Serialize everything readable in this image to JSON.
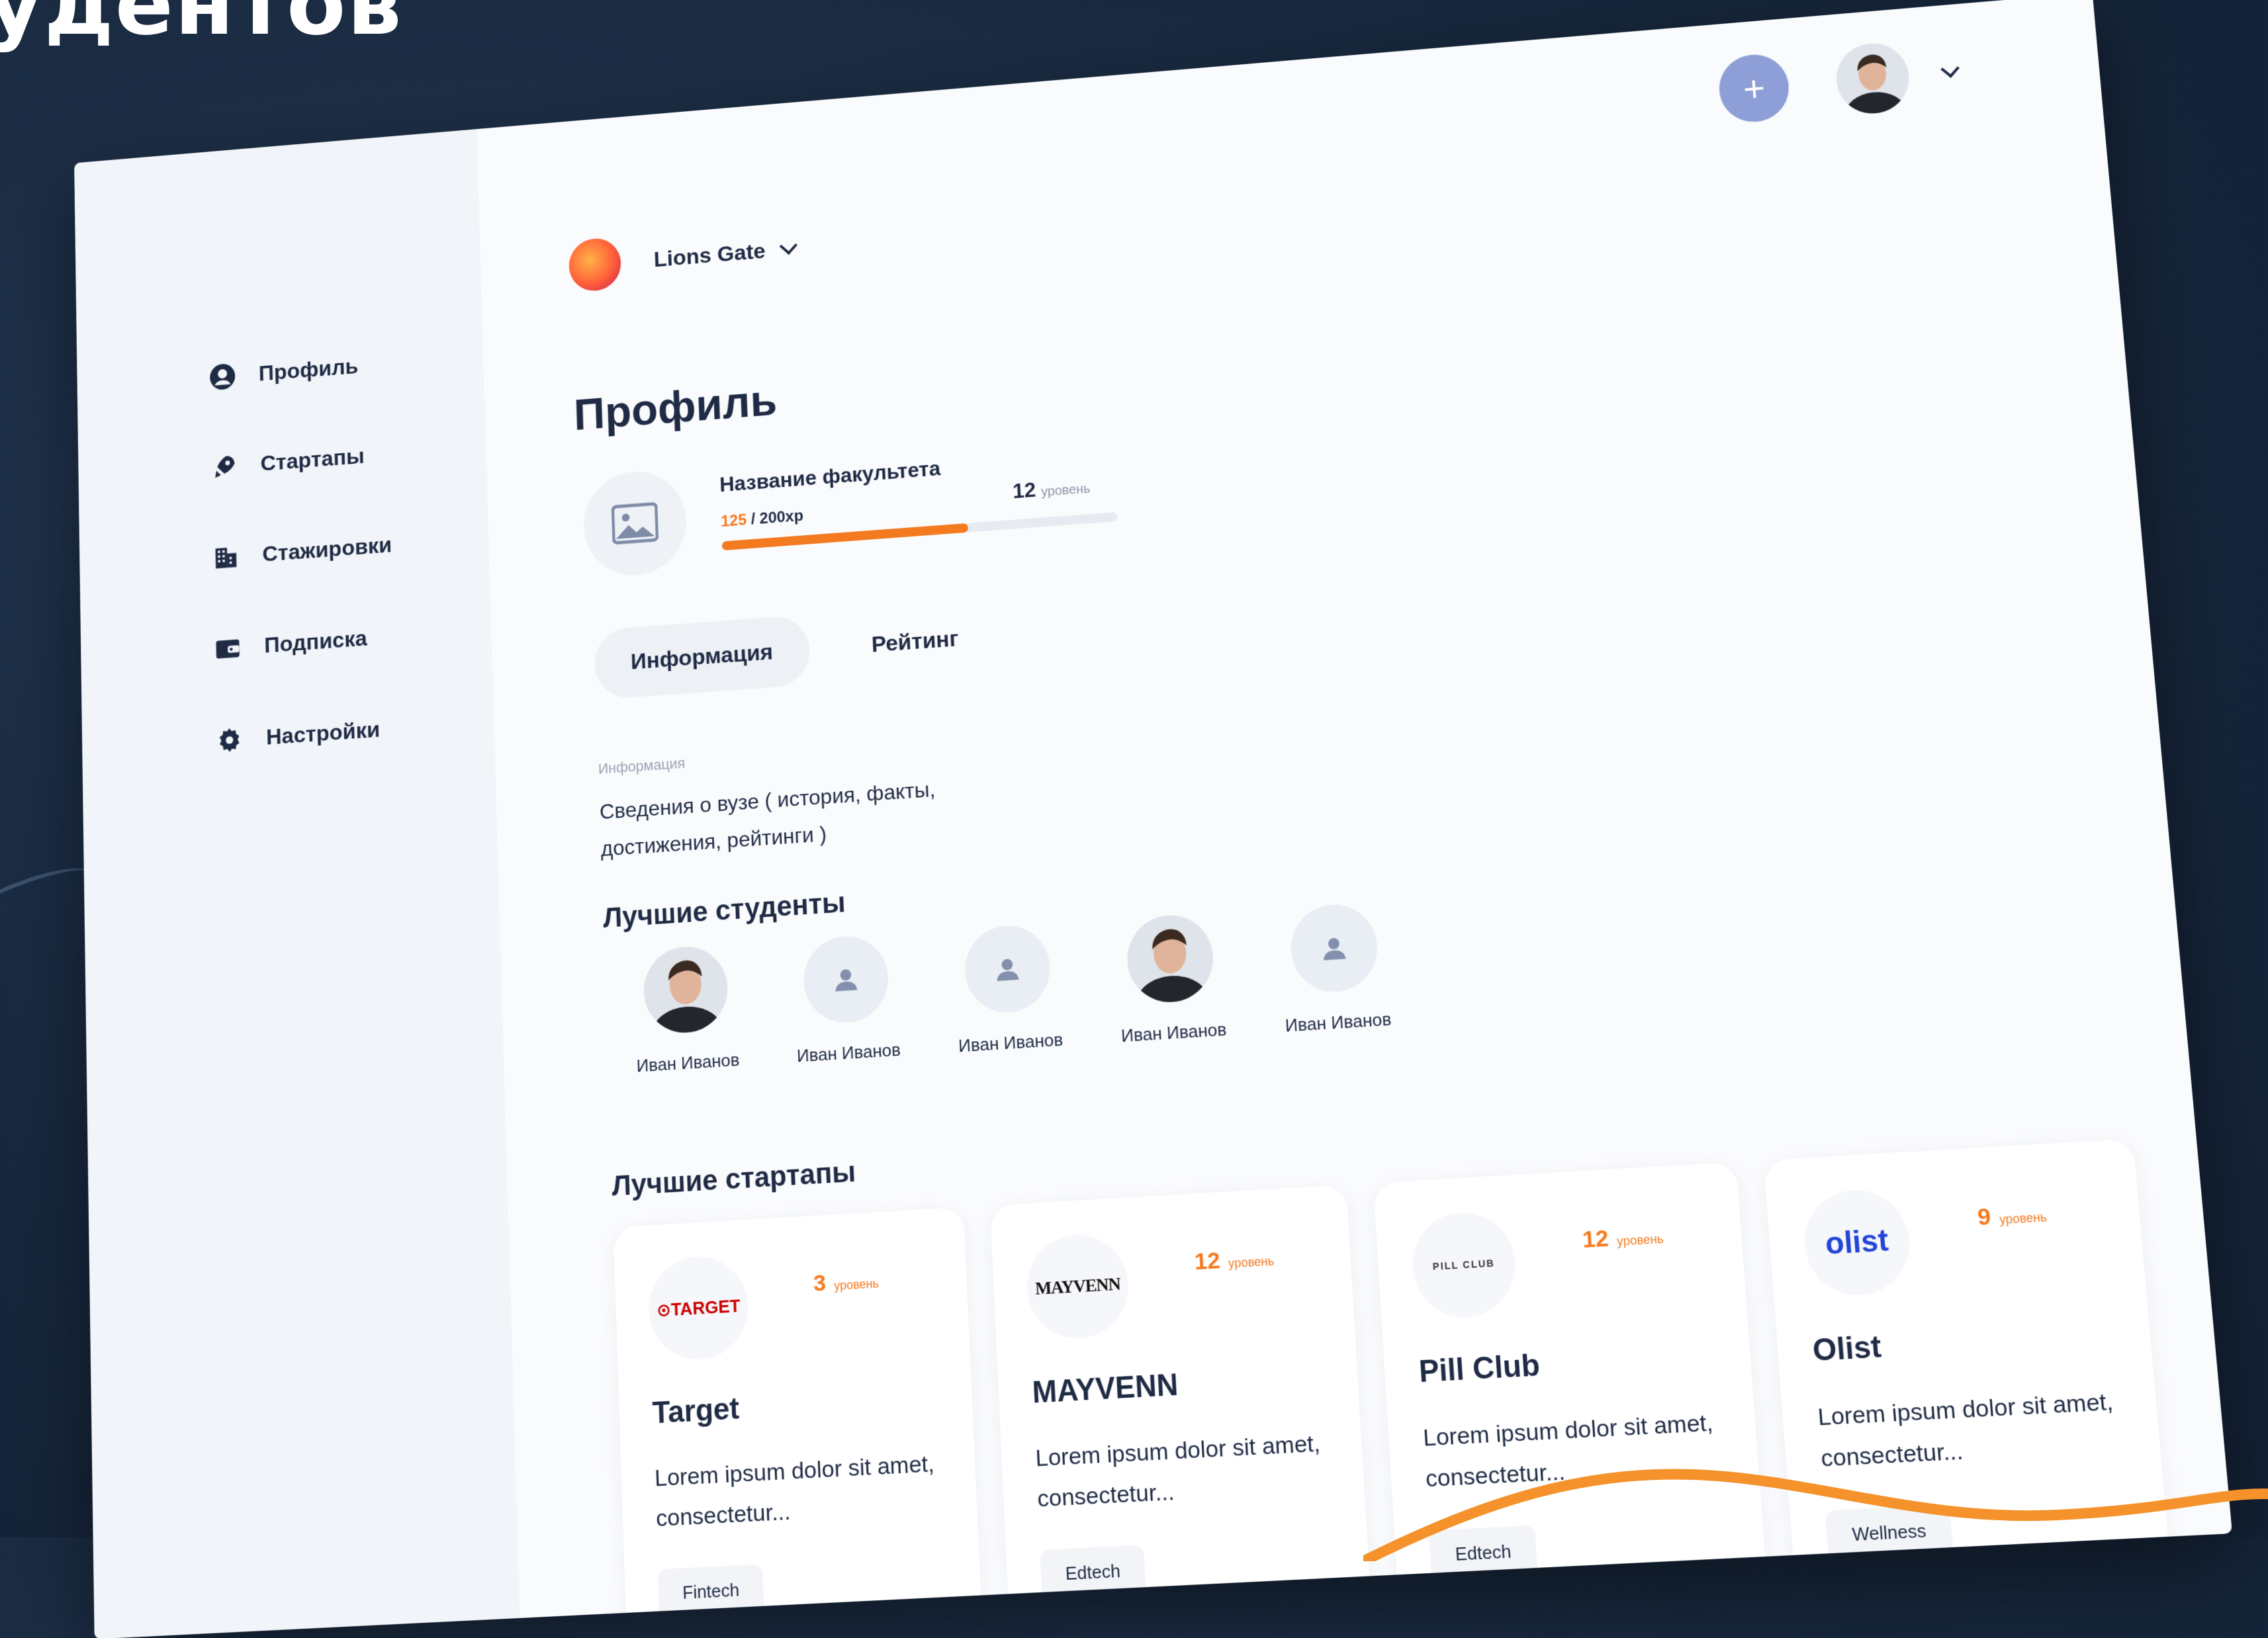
{
  "backdrop": {
    "title_fragment": "удентов"
  },
  "sidebar": {
    "items": [
      {
        "label": "Профиль",
        "icon": "user-circle-icon"
      },
      {
        "label": "Стартапы",
        "icon": "rocket-icon"
      },
      {
        "label": "Стажировки",
        "icon": "buildings-icon"
      },
      {
        "label": "Подписка",
        "icon": "wallet-icon"
      },
      {
        "label": "Настройки",
        "icon": "gear-icon"
      }
    ]
  },
  "header": {
    "org_name": "Lions Gate",
    "add_label": "+"
  },
  "page": {
    "title": "Профиль"
  },
  "faculty": {
    "name": "Название факультета",
    "xp_current": "125",
    "xp_total": " / 200xp",
    "xp_fraction": 0.625,
    "level_number": "12",
    "level_label": "уровень"
  },
  "tabs": [
    {
      "label": "Информация",
      "active": true
    },
    {
      "label": "Рейтинг",
      "active": false
    }
  ],
  "info": {
    "label": "Информация",
    "text": "Сведения о вузе ( история, факты, достижения, рейтинги )"
  },
  "students_section": {
    "title": "Лучшие студенты",
    "students": [
      {
        "name": "Иван Иванов",
        "avatar": "photo"
      },
      {
        "name": "Иван Иванов",
        "avatar": "placeholder"
      },
      {
        "name": "Иван Иванов",
        "avatar": "placeholder"
      },
      {
        "name": "Иван Иванов",
        "avatar": "photo"
      },
      {
        "name": "Иван Иванов",
        "avatar": "placeholder"
      }
    ]
  },
  "startups_section": {
    "title": "Лучшие стартапы",
    "startups": [
      {
        "logo_text": "⊙TARGET",
        "level": "3",
        "level_label": "уровень",
        "name": "Target",
        "desc": "Lorem ipsum dolor sit amet, consectetur...",
        "tag": "Fintech"
      },
      {
        "logo_text": "MAYVENN",
        "level": "12",
        "level_label": "уровень",
        "name": "MAYVENN",
        "desc": "Lorem ipsum dolor sit amet, consectetur...",
        "tag": "Edtech"
      },
      {
        "logo_text": "PILL CLUB",
        "level": "12",
        "level_label": "уровень",
        "name": "Pill Club",
        "desc": "Lorem ipsum dolor sit amet, consectetur...",
        "tag": "Edtech"
      },
      {
        "logo_text": "olist",
        "level": "9",
        "level_label": "уровень",
        "name": "Olist",
        "desc": "Lorem ipsum dolor sit amet, consectetur...",
        "tag": "Wellness"
      }
    ]
  },
  "colors": {
    "accent_orange": "#f47a20",
    "primary_text": "#1f2a44",
    "add_button": "#8e9fd8",
    "backdrop": "#16263b"
  }
}
